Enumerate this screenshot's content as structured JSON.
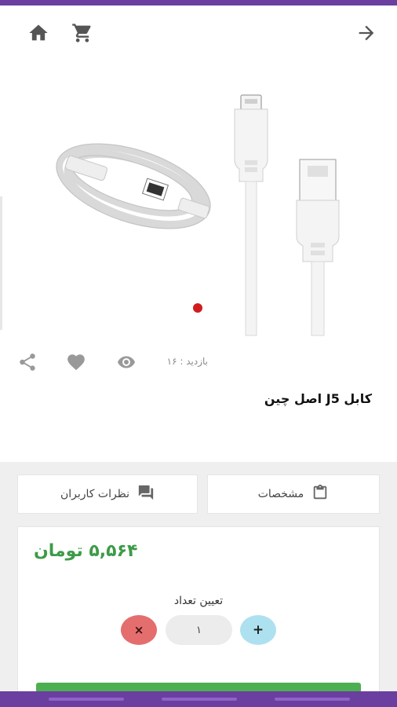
{
  "header": {
    "home_icon": "home-icon",
    "cart_icon": "cart-icon",
    "back_icon": "arrow-right-icon"
  },
  "product": {
    "image_alt": "USB cable",
    "carousel_active_color": "#d21c1c",
    "visits_text": "بازدید : ۱۶",
    "title": "کابل J5 اصل چین"
  },
  "tabs": [
    {
      "label": "مشخصات",
      "icon": "clipboard-icon"
    },
    {
      "label": "نظرات کاربران",
      "icon": "comments-icon"
    }
  ],
  "purchase": {
    "price": "۵,۵۶۴ تومان",
    "quantity_label": "تعیین تعداد",
    "quantity_value": "۱",
    "add_symbol": "+",
    "remove_symbol": "×"
  },
  "colors": {
    "accent": "#6a3fa0",
    "price": "#3d9b48",
    "buy": "#4caf50",
    "remove": "#e46e6e",
    "add": "#aee1f0"
  }
}
